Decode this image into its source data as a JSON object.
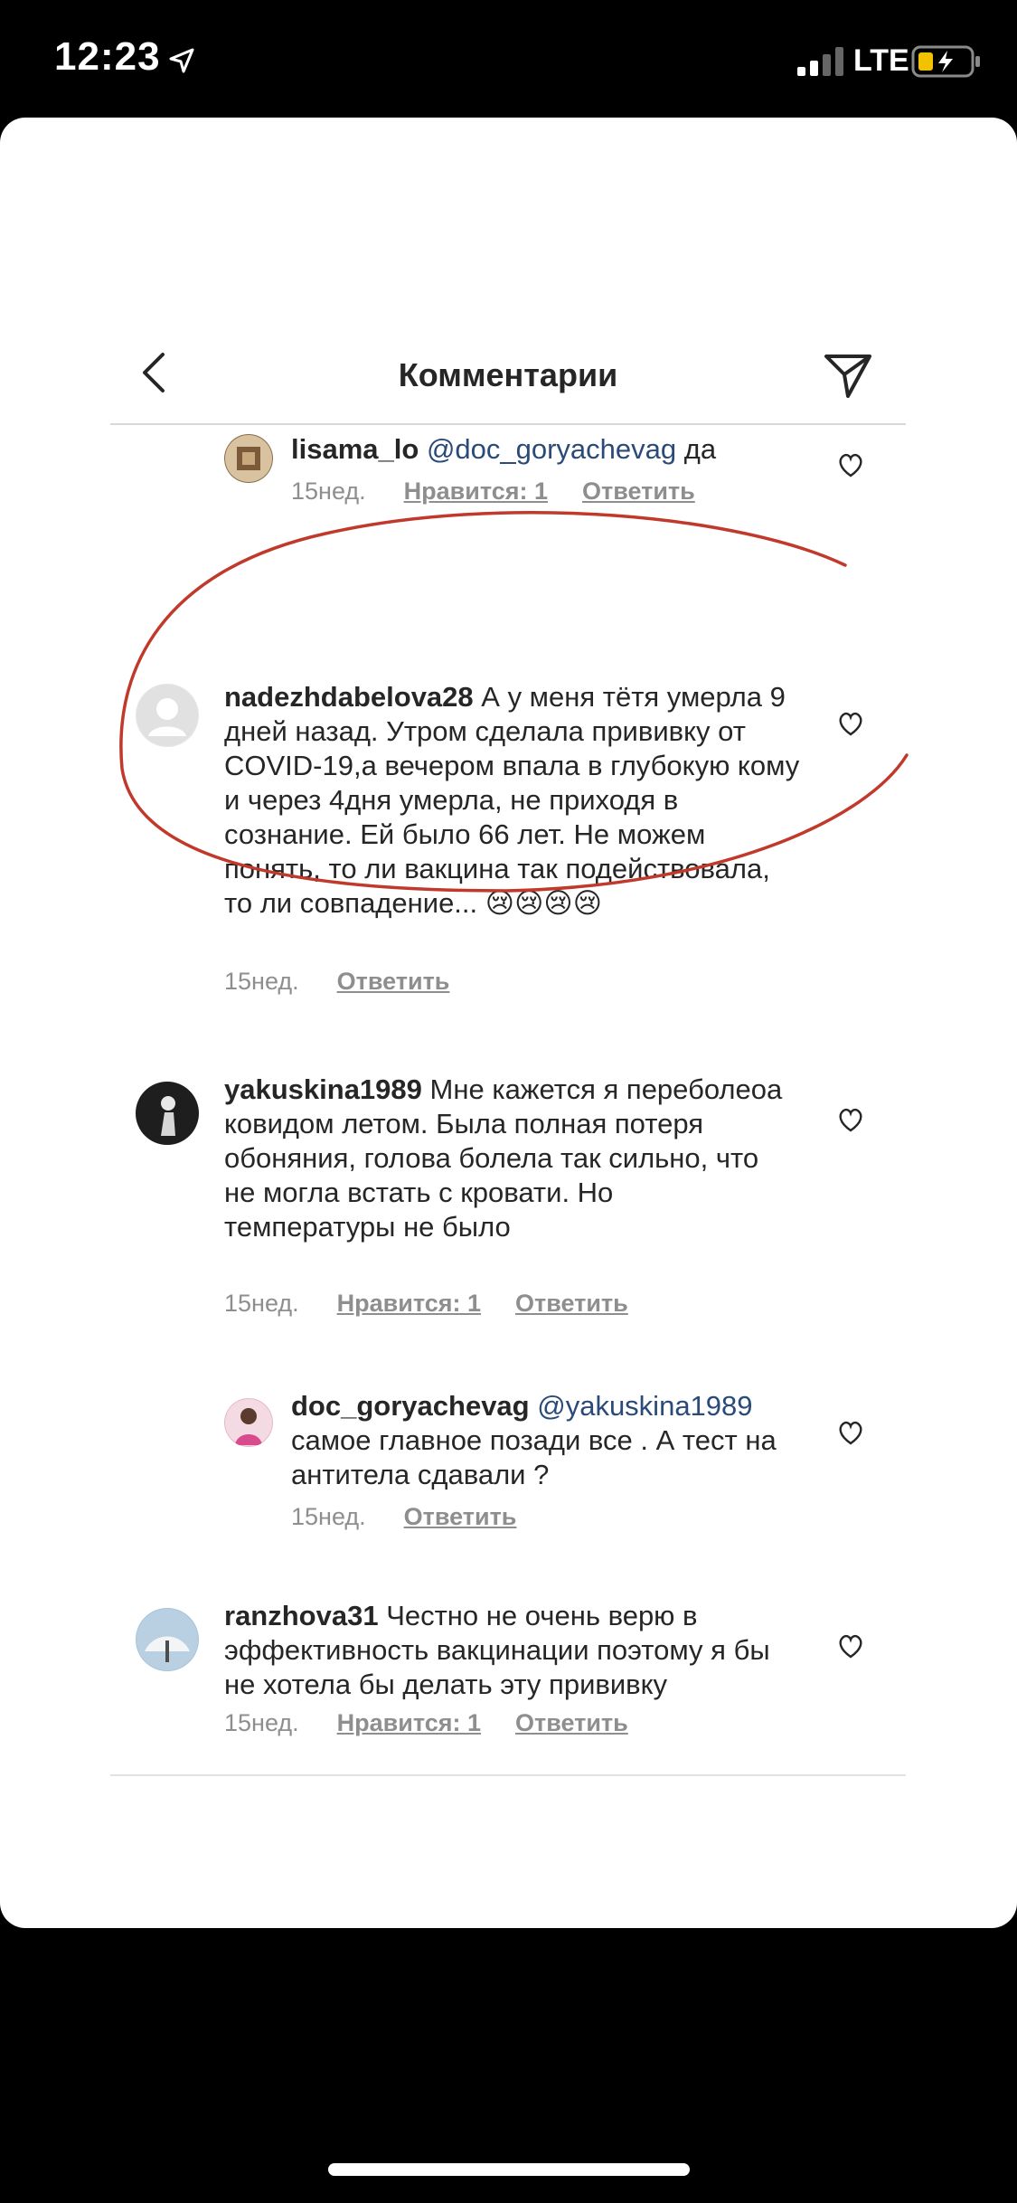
{
  "status_bar": {
    "time": "12:23",
    "network": "LTE"
  },
  "header": {
    "title": "Комментарии"
  },
  "comments": [
    {
      "username": "lisama_lo",
      "mention": "@doc_goryachevag",
      "text": "да",
      "time": "15нед.",
      "likes": "Нравится: 1",
      "reply": "Ответить"
    },
    {
      "username": "nadezhdabelova28",
      "mention": "",
      "text": "А у меня тётя умерла 9 дней назад. Утром сделала прививку от COVID-19,а вечером впала в глубокую кому и через 4дня умерла, не приходя в сознание. Ей было 66 лет. Не можем понять, то ли вакцина так подействовала, то ли совпадение... 😢😢😢😢",
      "time": "15нед.",
      "likes": "",
      "reply": "Ответить"
    },
    {
      "username": "yakuskina1989",
      "mention": "",
      "text": "Мне кажется я переболеоа ковидом летом. Была полная потеря обоняния, голова болела так сильно, что не могла встать с кровати. Но температуры не было",
      "time": "15нед.",
      "likes": "Нравится: 1",
      "reply": "Ответить"
    },
    {
      "username": "doc_goryachevag",
      "mention": "@yakuskina1989",
      "text": "самое главное позади все . А тест на антитела сдавали ?",
      "time": "15нед.",
      "likes": "",
      "reply": "Ответить"
    },
    {
      "username": "ranzhova31",
      "mention": "",
      "text": "Честно не очень верю в эффективность вакцинации поэтому я бы не хотела бы делать эту прививку",
      "time": "15нед.",
      "likes": "Нравится: 1",
      "reply": "Ответить"
    }
  ],
  "colors": {
    "annotation_red": "#c0392b",
    "mention_blue": "#2a4a7a",
    "meta_gray": "#8e8e8e"
  }
}
